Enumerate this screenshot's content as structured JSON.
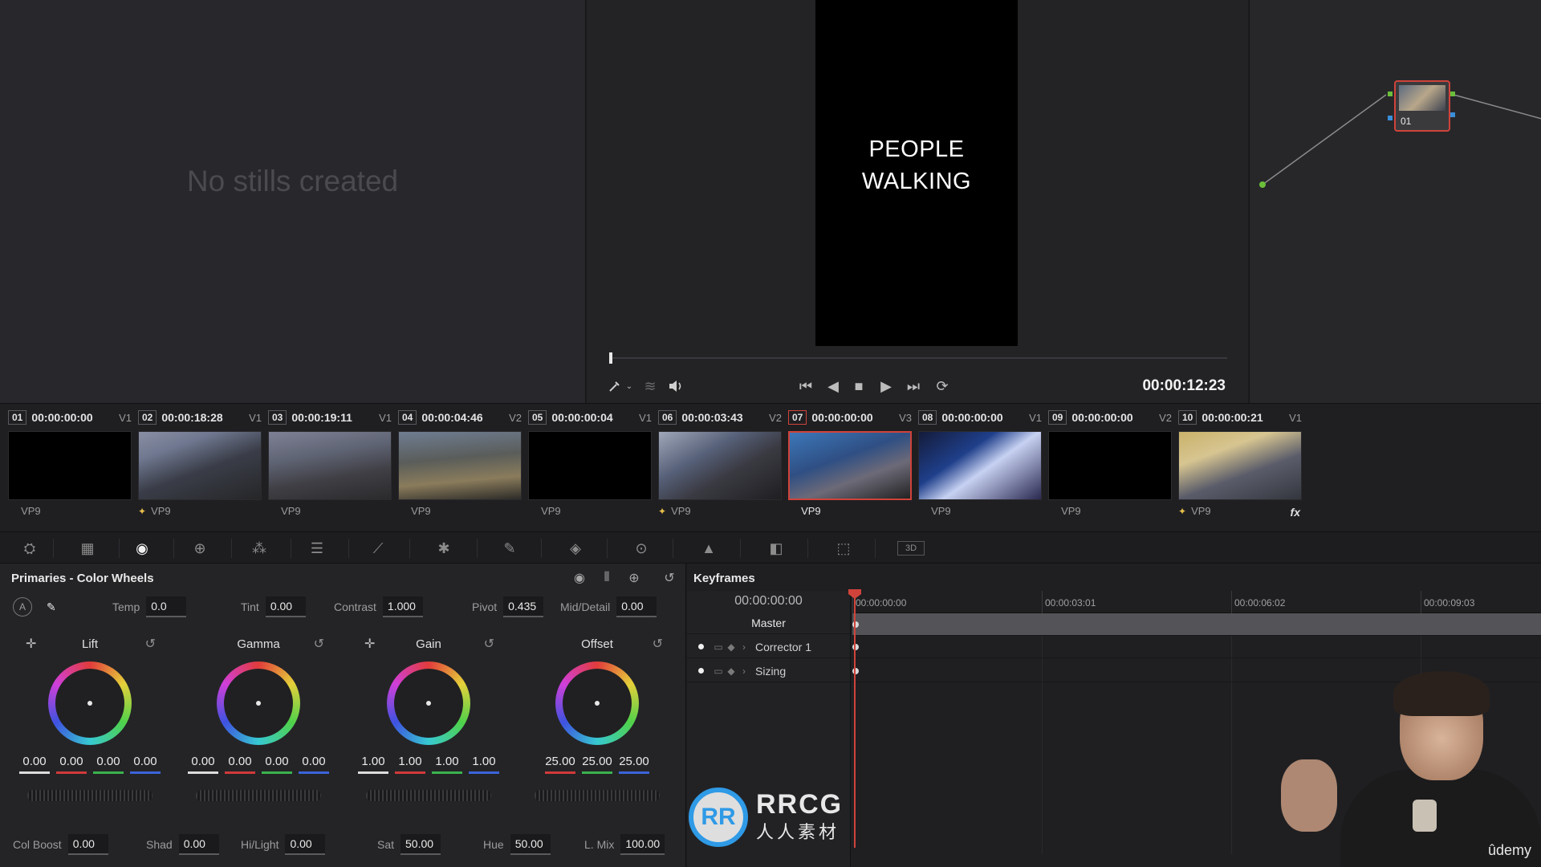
{
  "stills": {
    "empty_text": "No stills created"
  },
  "viewer": {
    "overlay_line1": "PEOPLE",
    "overlay_line2": "WALKING",
    "timecode": "00:00:12:23",
    "transport_icons": [
      "picker-icon",
      "layers-icon",
      "volume-icon",
      "skip-start-icon",
      "step-back-icon",
      "stop-icon",
      "play-icon",
      "skip-end-icon",
      "loop-icon"
    ]
  },
  "node_graph": {
    "node_label": "01"
  },
  "clips": [
    {
      "num": "01",
      "tc": "00:00:00:00",
      "track": "V1",
      "codec": "VP9",
      "mark": false,
      "thumb": "black"
    },
    {
      "num": "02",
      "tc": "00:00:18:28",
      "track": "V1",
      "codec": "VP9",
      "mark": true,
      "thumb": "crowd1"
    },
    {
      "num": "03",
      "tc": "00:00:19:11",
      "track": "V1",
      "codec": "VP9",
      "mark": false,
      "thumb": "crowd2"
    },
    {
      "num": "04",
      "tc": "00:00:04:46",
      "track": "V2",
      "codec": "VP9",
      "mark": false,
      "thumb": "crowd3"
    },
    {
      "num": "05",
      "tc": "00:00:00:04",
      "track": "V1",
      "codec": "VP9",
      "mark": false,
      "thumb": "black"
    },
    {
      "num": "06",
      "tc": "00:00:03:43",
      "track": "V2",
      "codec": "VP9",
      "mark": true,
      "thumb": "crowd4"
    },
    {
      "num": "07",
      "tc": "00:00:00:00",
      "track": "V3",
      "codec": "VP9",
      "mark": false,
      "thumb": "crowd5",
      "active": true
    },
    {
      "num": "08",
      "tc": "00:00:00:00",
      "track": "V1",
      "codec": "VP9",
      "mark": false,
      "thumb": "crowd6"
    },
    {
      "num": "09",
      "tc": "00:00:00:00",
      "track": "V2",
      "codec": "VP9",
      "mark": false,
      "thumb": "black"
    },
    {
      "num": "10",
      "tc": "00:00:00:21",
      "track": "V1",
      "codec": "VP9",
      "mark": true,
      "thumb": "crowd7",
      "fx": "fx"
    }
  ],
  "primaries": {
    "title": "Primaries - Color Wheels",
    "temp_label": "Temp",
    "temp": "0.0",
    "tint_label": "Tint",
    "tint": "0.00",
    "contrast_label": "Contrast",
    "contrast": "1.000",
    "pivot_label": "Pivot",
    "pivot": "0.435",
    "middetail_label": "Mid/Detail",
    "middetail": "0.00",
    "wheels": [
      {
        "name": "Lift",
        "values": [
          "0.00",
          "0.00",
          "0.00",
          "0.00"
        ]
      },
      {
        "name": "Gamma",
        "values": [
          "0.00",
          "0.00",
          "0.00",
          "0.00"
        ]
      },
      {
        "name": "Gain",
        "values": [
          "1.00",
          "1.00",
          "1.00",
          "1.00"
        ]
      },
      {
        "name": "Offset",
        "values": [
          "25.00",
          "25.00",
          "25.00"
        ]
      }
    ],
    "colboost_label": "Col Boost",
    "colboost": "0.00",
    "shad_label": "Shad",
    "shad": "0.00",
    "hilight_label": "Hi/Light",
    "hilight": "0.00",
    "sat_label": "Sat",
    "sat": "50.00",
    "hue_label": "Hue",
    "hue": "50.00",
    "lmix_label": "L. Mix",
    "lmix": "100.00"
  },
  "keyframes": {
    "title": "Keyframes",
    "timecode": "00:00:00:00",
    "master": "Master",
    "rows": [
      "Corrector 1",
      "Sizing"
    ],
    "ruler": [
      "00:00:00:00",
      "00:00:03:01",
      "00:00:06:02",
      "00:00:09:03"
    ]
  },
  "watermark": {
    "logo": "RR",
    "text_en": "RRCG",
    "text_cn": "人人素材"
  },
  "presenter": {
    "brand": "ûdemy"
  }
}
